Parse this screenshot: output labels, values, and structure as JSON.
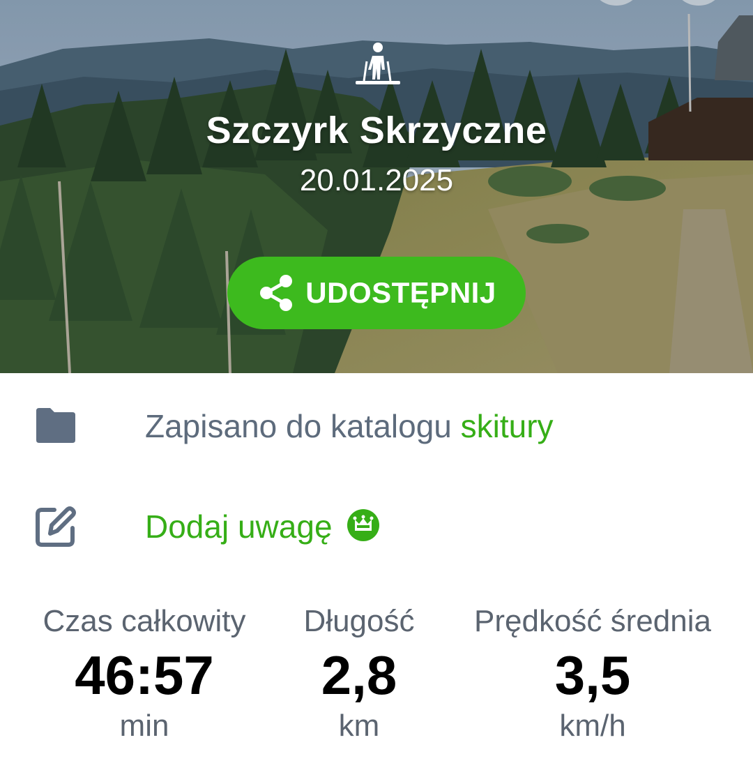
{
  "hero": {
    "title": "Szczyrk Skrzyczne",
    "date": "20.01.2025",
    "activity_icon": "nordic-walking-icon",
    "share_button": {
      "label": "UDOSTĘPNIJ",
      "icon": "share-icon"
    }
  },
  "folder_row": {
    "icon": "folder-icon",
    "text": "Zapisano do katalogu",
    "catalog_name": "skitury"
  },
  "note_row": {
    "icon": "edit-icon",
    "label": "Dodaj uwagę",
    "badge_icon": "premium-crown-icon"
  },
  "stats": [
    {
      "label": "Czas całkowity",
      "value": "46:57",
      "unit": "min"
    },
    {
      "label": "Długość",
      "value": "2,8",
      "unit": "km"
    },
    {
      "label": "Prędkość średnia",
      "value": "3,5",
      "unit": "km/h"
    }
  ],
  "colors": {
    "accent_green": "#3dba1e",
    "link_green": "#36ae17",
    "secondary_text": "#5d6b7c",
    "primary_text": "#000000"
  }
}
